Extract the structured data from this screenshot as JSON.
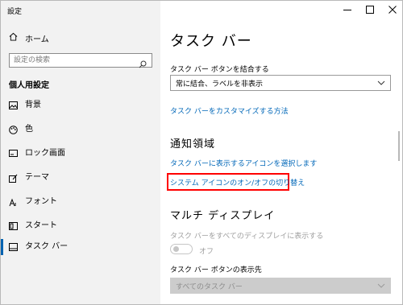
{
  "window": {
    "app_title": "設定",
    "controls": {
      "minimize_icon": "minimize-icon",
      "maximize_icon": "maximize-icon",
      "close_icon": "close-icon"
    }
  },
  "sidebar": {
    "home_label": "ホーム",
    "search": {
      "placeholder": "設定の検索",
      "value": ""
    },
    "section_label": "個人用設定",
    "items": [
      {
        "label": "背景",
        "icon": "image-icon"
      },
      {
        "label": "色",
        "icon": "palette-icon"
      },
      {
        "label": "ロック画面",
        "icon": "lock-screen-icon"
      },
      {
        "label": "テーマ",
        "icon": "theme-icon"
      },
      {
        "label": "フォント",
        "icon": "font-icon"
      },
      {
        "label": "スタート",
        "icon": "start-icon"
      },
      {
        "label": "タスク バー",
        "icon": "taskbar-icon",
        "active": true
      }
    ]
  },
  "main": {
    "page_title": "タスク バー",
    "combine": {
      "label": "タスク バー ボタンを結合する",
      "selected": "常に結合、ラベルを非表示"
    },
    "customize_link": "タスク バーをカスタマイズする方法",
    "notification": {
      "title": "通知領域",
      "link_select_icons": "タスク バーに表示するアイコンを選択します",
      "link_system_icons": "システム アイコンのオン/オフの切り替え"
    },
    "multi_display": {
      "title": "マルチ ディスプレイ",
      "show_all_label": "タスク バーをすべてのディスプレイに表示する",
      "toggle_state": "オフ",
      "buttons_where_label": "タスク バー ボタンの表示先",
      "buttons_where_selected": "すべてのタスク バー"
    }
  },
  "colors": {
    "accent": "#0063b1",
    "link": "#0067b8",
    "highlight": "#ff0000"
  }
}
